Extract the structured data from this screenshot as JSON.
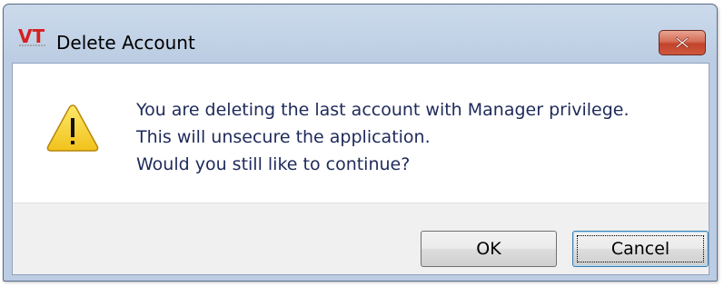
{
  "window": {
    "title": "Delete Account",
    "app_icon_text": "VT"
  },
  "message": {
    "lines": [
      "You are deleting the last account with Manager privilege.",
      "This will unsecure the application.",
      "Would you still like to continue?"
    ],
    "icon": "warning-icon"
  },
  "buttons": {
    "ok_label": "OK",
    "cancel_label": "Cancel"
  },
  "colors": {
    "close_button": "#c7462d",
    "message_text": "#1e2a5a",
    "warning_fill": "#f5d02a"
  }
}
